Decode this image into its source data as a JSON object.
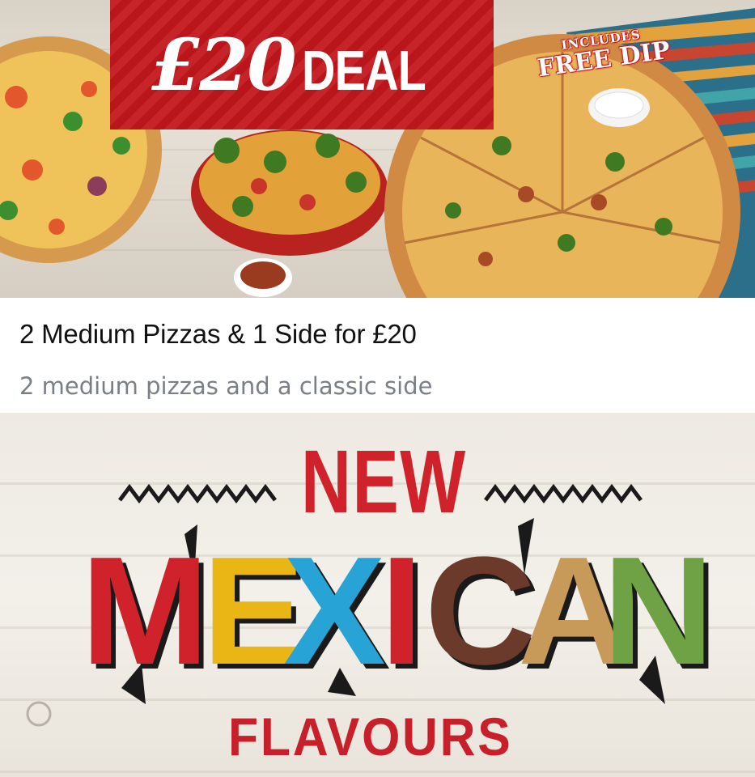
{
  "deal_banner": {
    "currency": "£",
    "amount": "20",
    "word": "DEAL",
    "badge_top": "INCLUDES",
    "badge_main": "FREE DIP",
    "colors": {
      "red": "#c4161c"
    }
  },
  "offer": {
    "title": "2 Medium Pizzas & 1 Side for £20",
    "subtitle": "2 medium pizzas and a classic side"
  },
  "promo_banner": {
    "new": "NEW",
    "mexican_letters": [
      "M",
      "E",
      "X",
      "I",
      "C",
      "A",
      "N"
    ],
    "flavours": "FLAVOURS",
    "colors": {
      "red": "#d0222a",
      "yellow": "#e9b616",
      "blue": "#27a3d6",
      "brown": "#6b3a2a",
      "tan": "#c79a5a",
      "green": "#6fa245"
    }
  }
}
